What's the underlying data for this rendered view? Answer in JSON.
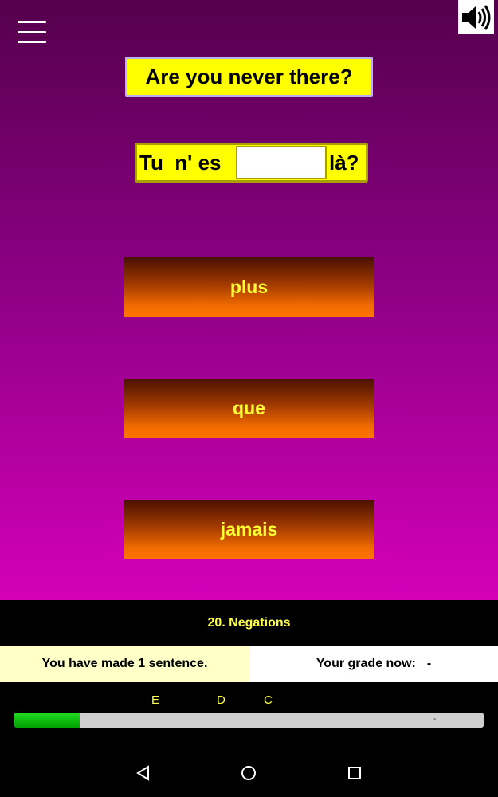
{
  "header": {
    "menu_icon": "hamburger-menu-icon",
    "sound_icon": "speaker-icon"
  },
  "prompt": {
    "text": "Are you never there?"
  },
  "sentence": {
    "before": "Tu  n' es",
    "after": "là?",
    "blank_value": ""
  },
  "options": [
    {
      "label": "plus"
    },
    {
      "label": "que"
    },
    {
      "label": "jamais"
    }
  ],
  "lesson": {
    "title": "20. Negations"
  },
  "stats": {
    "sentences_made": "You have made 1 sentence.",
    "grade_label": "Your grade now:",
    "grade_value": "-"
  },
  "grade_scale": {
    "labels": [
      "E",
      "D",
      "C"
    ],
    "progress": 0.14,
    "end_mark": "-"
  },
  "colors": {
    "bg_top": "#55004d",
    "bg_bottom": "#d400b8",
    "prompt_bg": "#ffff00",
    "option_text": "#ffff33",
    "option_bottom": "#ff7500",
    "progress_fill": "#00a000"
  },
  "navbar": {
    "icons": [
      "back-icon",
      "home-icon",
      "recent-apps-icon"
    ]
  }
}
